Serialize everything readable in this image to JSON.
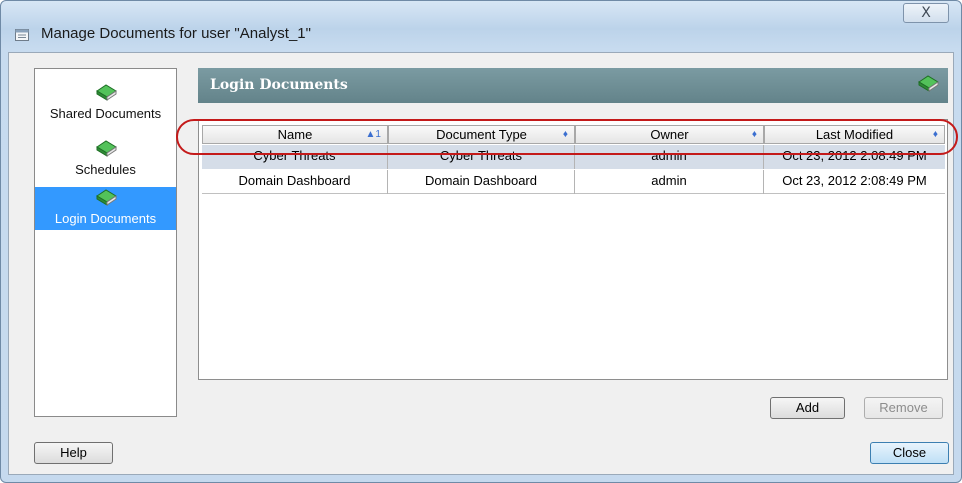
{
  "window": {
    "title": "Manage Documents for user \"Analyst_1\"",
    "close_symbol": "X",
    "title_icon": "document-window-icon"
  },
  "sidebar": {
    "items": [
      {
        "label": "Shared Documents",
        "icon": "book-icon",
        "selected": false
      },
      {
        "label": "Schedules",
        "icon": "book-icon",
        "selected": false
      },
      {
        "label": "Login Documents",
        "icon": "book-icon",
        "selected": true
      }
    ]
  },
  "panel": {
    "title": "Login Documents",
    "icon": "book-icon"
  },
  "table": {
    "columns": [
      {
        "label": "Name",
        "sort_indicator": "▲1"
      },
      {
        "label": "Document Type",
        "sort_indicator": "♦"
      },
      {
        "label": "Owner",
        "sort_indicator": "♦"
      },
      {
        "label": "Last Modified",
        "sort_indicator": "♦"
      }
    ],
    "rows": [
      {
        "name": "Cyber Threats",
        "type": "Cyber Threats",
        "owner": "admin",
        "modified": "Oct 23, 2012 2:08:49 PM"
      },
      {
        "name": "Domain Dashboard",
        "type": "Domain Dashboard",
        "owner": "admin",
        "modified": "Oct 23, 2012 2:08:49 PM"
      }
    ]
  },
  "buttons": {
    "add": "Add",
    "remove": "Remove",
    "help": "Help",
    "close": "Close"
  },
  "colors": {
    "panel_header": "#6f8f96",
    "selection": "#3399ff",
    "highlight_ring": "#c41a1a",
    "book_green": "#2f9a3a"
  }
}
